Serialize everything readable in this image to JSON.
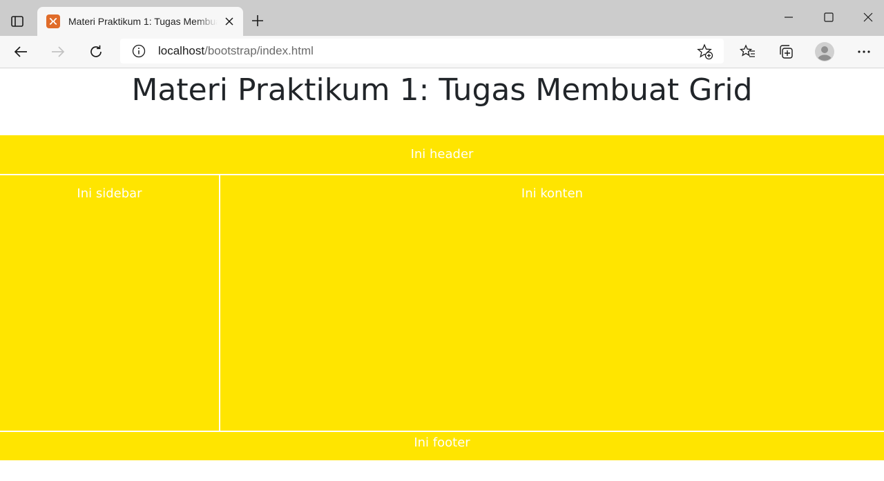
{
  "browser": {
    "tab": {
      "title": "Materi Praktikum 1: Tugas Membuat Grid"
    },
    "address": {
      "host": "localhost",
      "path": "/bootstrap/index.html"
    }
  },
  "page": {
    "title": "Materi Praktikum 1: Tugas Membuat Grid",
    "grid": {
      "header": "Ini header",
      "sidebar": "Ini sidebar",
      "content": "Ini konten",
      "footer": "Ini footer"
    }
  },
  "colors": {
    "grid_background": "#ffe500",
    "grid_text": "#ffffff",
    "title_text": "#212529",
    "tab_strip": "#cccccc",
    "favicon": "#e06c2a"
  },
  "icons": {
    "tab_actions": "tab-actions-icon",
    "favicon": "xampp-favicon-icon",
    "close": "close-icon",
    "new_tab": "plus-icon",
    "minimize": "minimize-icon",
    "maximize": "maximize-icon",
    "window_close": "window-close-icon",
    "back": "back-arrow-icon",
    "forward": "forward-arrow-icon",
    "refresh": "refresh-icon",
    "info": "info-icon",
    "add_favorite": "add-favorite-icon",
    "favorites": "favorites-icon",
    "collections": "collections-icon",
    "profile": "profile-avatar-icon",
    "more": "more-icon"
  }
}
